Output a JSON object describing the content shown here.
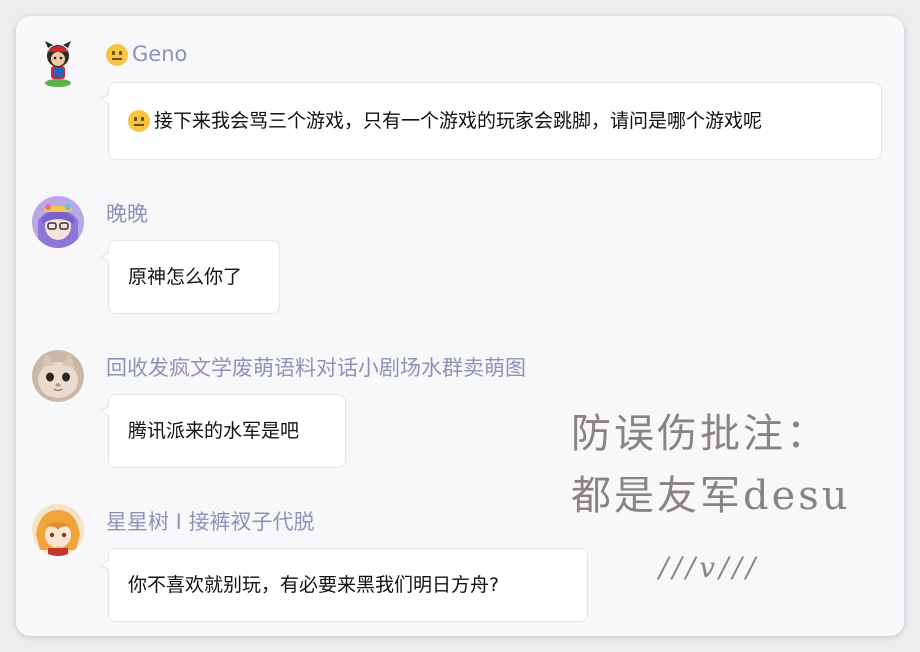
{
  "messages": [
    {
      "sender": "Geno",
      "text": "接下来我会骂三个游戏，只有一个游戏的玩家会跳脚，请问是哪个游戏呢",
      "sender_emoji": "neutral-face",
      "text_emoji": "neutral-face"
    },
    {
      "sender": "晚晚",
      "text": "原神怎么你了"
    },
    {
      "sender": "回收发疯文学废萌语料对话小剧场水群卖萌图",
      "text": "腾讯派来的水军是吧"
    },
    {
      "sender": "星星树 I 接裤衩子代脱",
      "text": "你不喜欢就别玩，有必要来黑我们明日方舟?"
    }
  ],
  "annotation": {
    "line1": "防误伤批注：",
    "line2": "都是友军desu",
    "line3": "///v///"
  },
  "colors": {
    "name": "#8d93b8",
    "annotation": "#8a8384",
    "bubble": "#ffffff",
    "card": "#f8f8fa"
  }
}
